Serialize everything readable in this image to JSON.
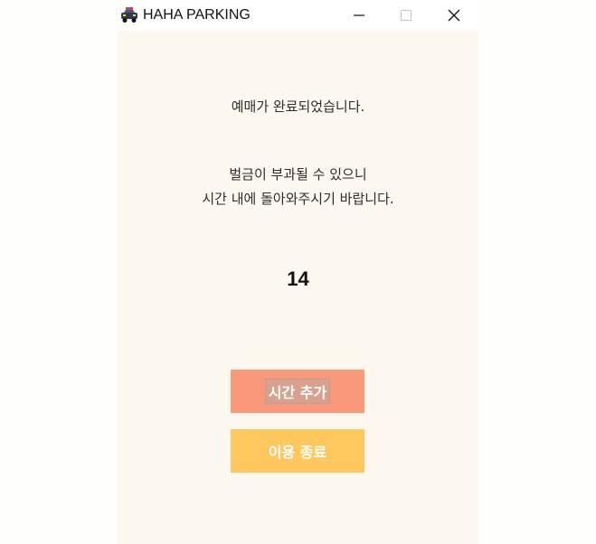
{
  "window": {
    "title": "HAHA PARKING",
    "controls": {
      "minimize": "—",
      "maximize": "☐",
      "close": "✕"
    },
    "icon": "car-icon"
  },
  "message": {
    "line1": "예매가 완료되었습니다.",
    "line2": "벌금이 부과될 수 있으니",
    "line3": "시간 내에 돌아와주시기 바랍니다."
  },
  "counter": "14",
  "buttons": {
    "add_time": {
      "label": "시간 추가",
      "color": "#f9987a"
    },
    "end_use": {
      "label": "이용 종료",
      "color": "#ffc85e"
    }
  },
  "colors": {
    "window_bg": "#fdf8ef"
  }
}
